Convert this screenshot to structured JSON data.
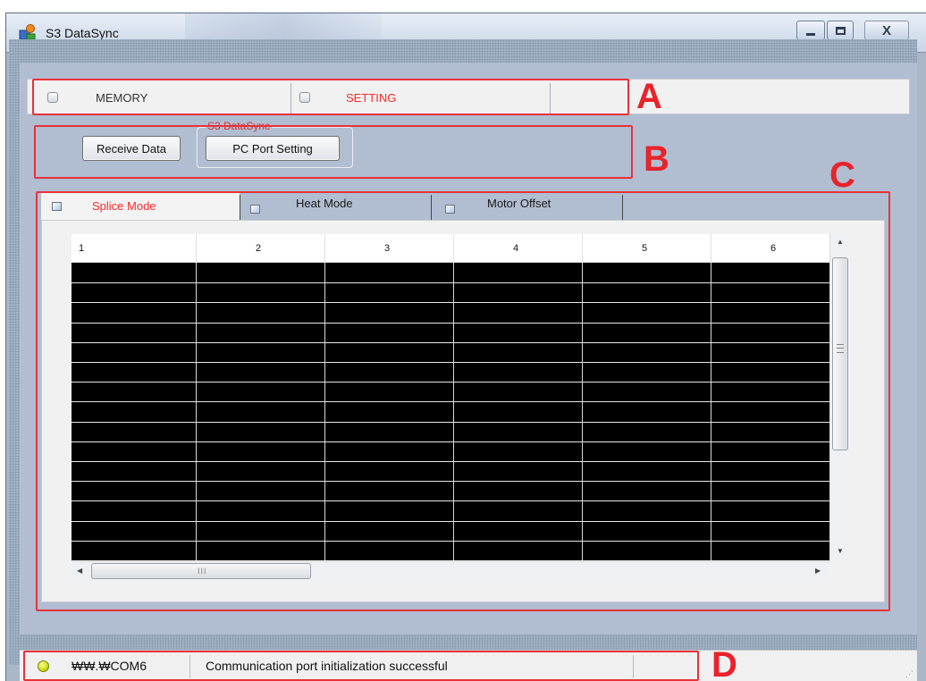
{
  "window": {
    "title": "S3 DataSync",
    "minimize_glyph": "",
    "close_glyph": "X"
  },
  "section_a": {
    "tabs": [
      {
        "label": "MEMORY",
        "color": "#333333"
      },
      {
        "label": "SETTING",
        "color": "#ff2a2a"
      }
    ]
  },
  "section_b": {
    "group_title": "S3 DataSync",
    "receive_label": "Receive Data",
    "port_setting_label": "PC Port Setting"
  },
  "section_c": {
    "tabs": [
      {
        "label": "Splice Mode",
        "active": true
      },
      {
        "label": "Heat Mode",
        "active": false
      },
      {
        "label": "Motor Offset",
        "active": false
      }
    ],
    "columns": [
      "1",
      "2",
      "3",
      "4",
      "5",
      "6"
    ],
    "row_count": 15,
    "h_scroll_grip": "III",
    "v_scroll_grip": "≡"
  },
  "status": {
    "port": "₩₩.₩COM6",
    "message": "Communication port initialization successful",
    "led_color": "#cddc1c"
  },
  "annotations": {
    "a": "A",
    "b": "B",
    "c": "C",
    "d": "D",
    "color": "#e8232b"
  }
}
